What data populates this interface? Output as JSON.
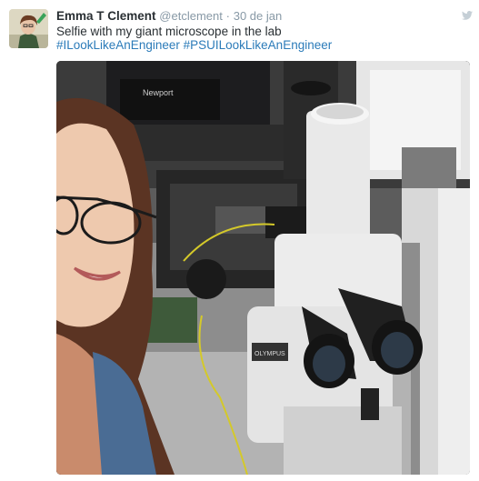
{
  "tweet": {
    "author_name": "Emma T Clement",
    "handle": "@etclement",
    "separator": "·",
    "timestamp": "30 de jan",
    "text": "Selfie with my giant microscope in the lab",
    "hashtags": [
      "#ILookLikeAnEngineer",
      "#PSUILookLikeAnEngineer"
    ],
    "icons": {
      "platform": "twitter-bird-icon"
    },
    "colors": {
      "name": "#292f33",
      "meta": "#8899a6",
      "link": "#2b7bb9"
    }
  },
  "photo": {
    "label_newport": "Newport",
    "label_scope": "OLYMPUS"
  }
}
